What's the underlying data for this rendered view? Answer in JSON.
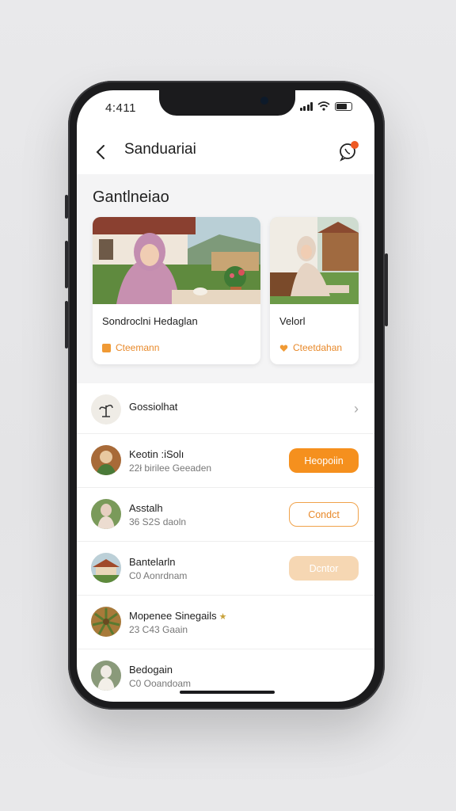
{
  "status": {
    "time": "4:411"
  },
  "header": {
    "title": "Sanduariai"
  },
  "section": {
    "title": "Gantlneiao"
  },
  "cards": [
    {
      "title": "Sondroclni Hedaglan",
      "tag": "Cteemann"
    },
    {
      "title": "Velorl",
      "tag": "Cteetdahan"
    }
  ],
  "list": [
    {
      "name": "Gossiolhat",
      "sub": "",
      "action": "chevron"
    },
    {
      "name": "Keotin :iSolı",
      "sub": "22ł birilee Geeaden",
      "button": "Heopoiin",
      "style": "solid"
    },
    {
      "name": "Asstalh",
      "sub": "36  S2S daoln",
      "button": "Condct",
      "style": "outline"
    },
    {
      "name": "Bantelarln",
      "sub": "C0  Aonrdnam",
      "button": "Dcntor",
      "style": "soft"
    },
    {
      "name": "Mopenee Sinegails",
      "sub": "23  C43 Gaain",
      "star": "★"
    },
    {
      "name": "Bedogain",
      "sub": "C0  Ooandoam"
    }
  ],
  "colors": {
    "accent": "#f5901e",
    "badge": "#ee5a24"
  }
}
